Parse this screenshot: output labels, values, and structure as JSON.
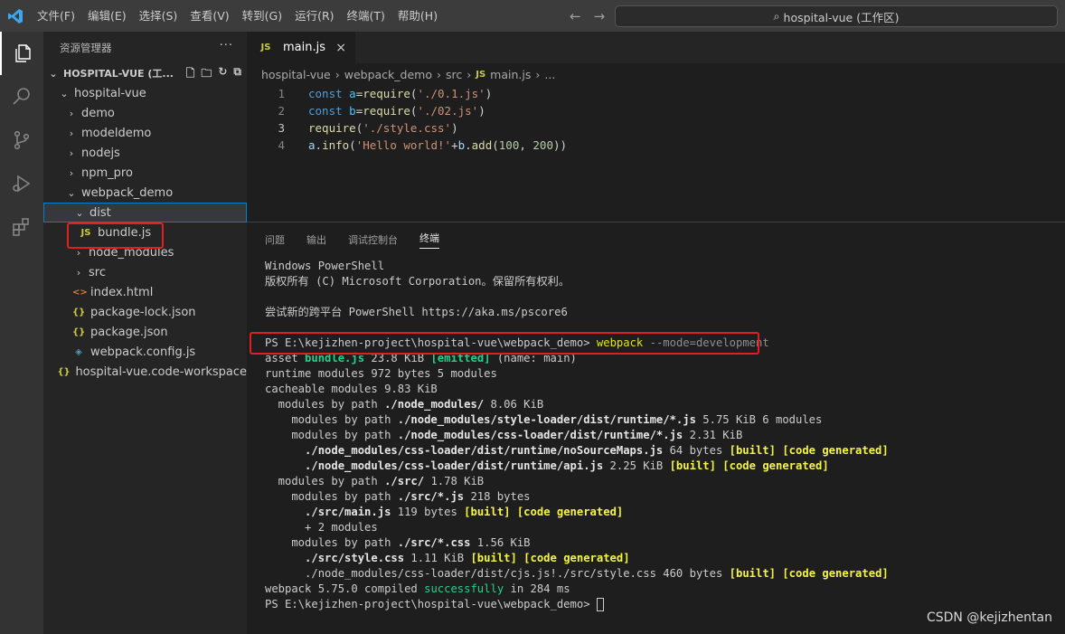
{
  "menu": [
    "文件(F)",
    "编辑(E)",
    "选择(S)",
    "查看(V)",
    "转到(G)",
    "运行(R)",
    "终端(T)",
    "帮助(H)"
  ],
  "search": {
    "text": "hospital-vue (工作区)"
  },
  "sidebar": {
    "title": "资源管理器",
    "workspace": "HOSPITAL-VUE (工...",
    "tree": [
      {
        "label": "hospital-vue",
        "kind": "folder-open",
        "indent": 1
      },
      {
        "label": "demo",
        "kind": "folder",
        "indent": 2
      },
      {
        "label": "modeldemo",
        "kind": "folder",
        "indent": 2
      },
      {
        "label": "nodejs",
        "kind": "folder",
        "indent": 2
      },
      {
        "label": "npm_pro",
        "kind": "folder",
        "indent": 2
      },
      {
        "label": "webpack_demo",
        "kind": "folder-open",
        "indent": 2
      },
      {
        "label": "dist",
        "kind": "folder-open",
        "indent": 3
      },
      {
        "label": "bundle.js",
        "kind": "js",
        "indent": 4
      },
      {
        "label": "node_modules",
        "kind": "folder",
        "indent": 3
      },
      {
        "label": "src",
        "kind": "folder",
        "indent": 3
      },
      {
        "label": "index.html",
        "kind": "html",
        "indent": 3
      },
      {
        "label": "package-lock.json",
        "kind": "json",
        "indent": 3
      },
      {
        "label": "package.json",
        "kind": "json",
        "indent": 3
      },
      {
        "label": "webpack.config.js",
        "kind": "config",
        "indent": 3
      },
      {
        "label": "hospital-vue.code-workspace",
        "kind": "json",
        "indent": 2
      }
    ]
  },
  "editor": {
    "tab": "main.js",
    "tab_badge": "JS",
    "breadcrumb": [
      "hospital-vue",
      "webpack_demo",
      "src",
      "main.js",
      "..."
    ],
    "line_numbers": [
      "1",
      "2",
      "3",
      "4"
    ]
  },
  "panel": {
    "tabs": [
      "问题",
      "输出",
      "调试控制台",
      "终端"
    ]
  },
  "terminal": {
    "l1": "Windows PowerShell",
    "l2": "版权所有 (C) Microsoft Corporation。保留所有权利。",
    "l3": "尝试新的跨平台 PowerShell https://aka.ms/pscore6",
    "prompt": "PS E:\\kejizhen-project\\hospital-vue\\webpack_demo>",
    "cmd": "webpack",
    "cmd_arg": "--mode=development",
    "asset": {
      "a": "asset ",
      "b": "bundle.js",
      "c": " 23.8 KiB ",
      "d": "[emitted]",
      "e": " (name: main)"
    },
    "runtime": "runtime modules 972 bytes 5 modules",
    "cacheable": "cacheable modules 9.83 KiB",
    "m1": {
      "a": "  modules by path ",
      "b": "./node_modules/",
      "c": " 8.06 KiB"
    },
    "m2": {
      "a": "    modules by path ",
      "b": "./node_modules/style-loader/dist/runtime/*.js",
      "c": " 5.75 KiB 6 modules"
    },
    "m3": {
      "a": "    modules by path ",
      "b": "./node_modules/css-loader/dist/runtime/*.js",
      "c": " 2.31 KiB"
    },
    "m4": {
      "a": "      ./node_modules/css-loader/dist/runtime/noSourceMaps.js",
      "c": " 64 bytes ",
      "d": "[built] [code generated]"
    },
    "m5": {
      "a": "      ./node_modules/css-loader/dist/runtime/api.js",
      "c": " 2.25 KiB ",
      "d": "[built] [code generated]"
    },
    "m6": {
      "a": "  modules by path ",
      "b": "./src/",
      "c": " 1.78 KiB"
    },
    "m7": {
      "a": "    modules by path ",
      "b": "./src/*.js",
      "c": " 218 bytes"
    },
    "m8": {
      "a": "      ./src/main.js",
      "c": " 119 bytes ",
      "d": "[built] [code generated]"
    },
    "m9": "      + 2 modules",
    "m10": {
      "a": "    modules by path ",
      "b": "./src/*.css",
      "c": " 1.56 KiB"
    },
    "m11": {
      "a": "      ./src/style.css",
      "c": " 1.11 KiB ",
      "d": "[built] [code generated]"
    },
    "m12": {
      "a": "      ./node_modules/css-loader/dist/cjs.js!./src/style.css",
      "c": " 460 bytes ",
      "d": "[built] [code generated]"
    },
    "done": {
      "a": "webpack 5.75.0 compiled ",
      "b": "successfully",
      "c": " in 284 ms"
    }
  },
  "watermark": "CSDN @kejizhentan",
  "colors": {
    "accent_border": "#e02020",
    "selection": "#007fd4"
  }
}
